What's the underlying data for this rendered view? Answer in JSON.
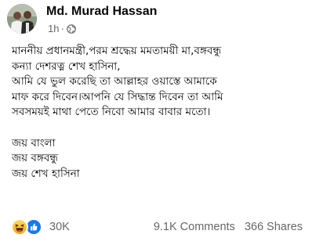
{
  "post": {
    "author": "Md. Murad Hassan",
    "time": "1h",
    "separator": "·",
    "audience_icon": "globe-icon",
    "body_lines": [
      "মাননীয় প্রধানমন্ত্রী,পরম শ্রদ্ধেয় মমতাময়ী মা,বঙ্গবন্ধু",
      "কন্যা দেশরত্ন শেখ হাসিনা,",
      "আমি যে ভুল করেছি তা আল্লাহর ওয়াস্তে আমাকে",
      "মাফ করে দিবেন।আপনি যে সিদ্ধান্ত দিবেন তা আমি",
      "সবসময়ই মাথা পেতে নিবো আমার বাবার মতো।"
    ],
    "slogan_lines": [
      "জয় বাংলা",
      "জয় বঙ্গবন্ধু",
      "জয় শেখ হাসিনা"
    ]
  },
  "footer": {
    "reaction_icons": [
      "haha-icon",
      "like-icon"
    ],
    "reaction_count": "30K",
    "comments": "9.1K Comments",
    "shares": "366 Shares"
  },
  "colors": {
    "text": "#050505",
    "secondary_text": "#65676b",
    "like_blue": "#1877f2",
    "haha_yellow": "#f7b125"
  }
}
